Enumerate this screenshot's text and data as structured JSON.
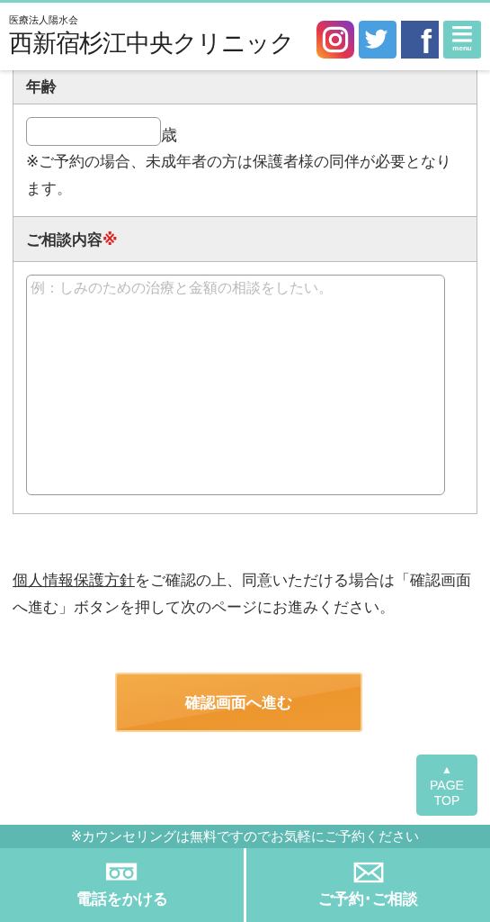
{
  "header": {
    "org": "医療法人陽水会",
    "clinic": "西新宿杉江中央クリニック",
    "social": [
      {
        "kind": "instagram"
      },
      {
        "kind": "twitter"
      },
      {
        "kind": "facebook",
        "glyph": "f"
      }
    ],
    "menu": {
      "label": "menu"
    }
  },
  "form": {
    "required_mark": "※",
    "fields": [
      {
        "kind": "age",
        "label": "年齢",
        "required": false,
        "unit": "歳",
        "note": "※ご予約の場合、未成年者の方は保護者様の同伴が必要となります。"
      },
      {
        "kind": "textarea",
        "label": "ご相談内容",
        "required": true,
        "placeholder": "例：しみのための治療と金額の相談をしたい。"
      }
    ]
  },
  "consent": {
    "link": "個人情報保護方針",
    "text": "をご確認の上、同意いただける場合は「確認画面へ進む」ボタンを押して次のページにお進みください。"
  },
  "submit": "確認画面へ進む",
  "page_top": {
    "arrow": "▲",
    "label": "PAGE TOP"
  },
  "footer": {
    "notice": "※カウンセリングは無料ですのでお気軽にご予約ください",
    "actions": [
      {
        "kind": "phone",
        "label": "電話をかける"
      },
      {
        "kind": "mail",
        "label": "ご予約･ご相談"
      }
    ]
  }
}
